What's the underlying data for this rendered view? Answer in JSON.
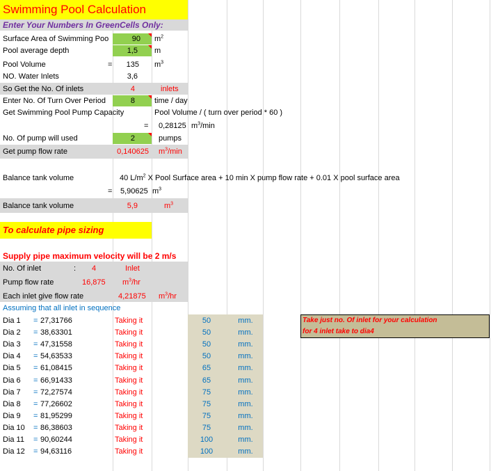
{
  "title": "Swimming Pool Calculation",
  "subtitle": "Enter Your Numbers In GreenCells Only:",
  "colors": {
    "yellow": "#ffff00",
    "green": "#92d050",
    "gray": "#d9d9d9",
    "tan": "#ddd9c4",
    "olive": "#c4bd97",
    "red": "#ff0000",
    "blue": "#0070c0"
  },
  "rows": {
    "surface_label": "Surface Area of Swimming Poo",
    "surface_value": "90",
    "surface_unit": "m",
    "surface_sup": "2",
    "depth_label": "Pool average depth",
    "depth_value": "1,5",
    "depth_unit": "m",
    "volume_label": "Pool Volume",
    "volume_eq": "=",
    "volume_value": "135",
    "volume_unit": "m",
    "volume_sup": "3",
    "inlets_label": "NO. Water Inlets",
    "inlets_value": "3,6",
    "get_inlets_label": "So Get the No. Of inlets",
    "get_inlets_value": "4",
    "get_inlets_unit": "inlets",
    "turnover_label": "Enter No. Of Turn Over Period",
    "turnover_value": "8",
    "turnover_unit": "time / day",
    "pump_cap_label": "Get Swimming Pool Pump Capacity",
    "pump_cap_formula": "Pool Volume / ( turn over period * 60 )",
    "pump_cap_eq": "=",
    "pump_cap_value": "0,28125",
    "pump_cap_unit_a": "m",
    "pump_cap_sup": "3",
    "pump_cap_unit_b": "/min",
    "pumps_label": "No. Of pump will used",
    "pumps_value": "2",
    "pumps_unit": "pumps",
    "flow_label": "Get pump flow rate",
    "flow_value": "0,140625",
    "flow_unit_a": "m",
    "flow_sup": "3",
    "flow_unit_b": "/min",
    "balance_label": "Balance tank volume",
    "balance_formula_a": "40 L/m",
    "balance_formula_sup": "2",
    "balance_formula_b": " X Pool Surface area  + 10 min X pump flow rate + 0.01 X pool surface area",
    "balance_eq": "=",
    "balance_calc": "5,90625",
    "balance_calc_unit": "m",
    "balance_calc_sup": "3",
    "balance2_label": "Balance tank volume",
    "balance2_value": "5,9",
    "balance2_unit": "m",
    "balance2_sup": "3"
  },
  "pipe_title": "To calculate pipe sizing",
  "supply_title": "Supply pipe maximum velocity will be 2 m/s",
  "supply": {
    "inlet_label": "No. Of inlet",
    "inlet_colon": ":",
    "inlet_value": "4",
    "inlet_unit": "Inlet",
    "pump_label": "Pump flow rate",
    "pump_value": "16,875",
    "pump_unit_a": "m",
    "pump_sup": "3",
    "pump_unit_b": "/hr",
    "each_label": "Each inlet give flow rate",
    "each_value": "4,21875",
    "each_unit_a": "m",
    "each_sup": "3",
    "each_unit_b": "/hr",
    "assume": "Assuming that all inlet in sequence"
  },
  "note": {
    "line1": "Take just no. Of inlet for your calculation",
    "line2": "for 4 inlet take to dia4"
  },
  "dia_rows": [
    {
      "name": "Dia 1",
      "eq": "=",
      "calc": "27,31766",
      "taking": "Taking it",
      "size": "50",
      "unit": "mm."
    },
    {
      "name": "Dia 2",
      "eq": "=",
      "calc": "38,63301",
      "taking": "Taking it",
      "size": "50",
      "unit": "mm."
    },
    {
      "name": "Dia 3",
      "eq": "=",
      "calc": "47,31558",
      "taking": "Taking it",
      "size": "50",
      "unit": "mm."
    },
    {
      "name": "Dia 4",
      "eq": "=",
      "calc": "54,63533",
      "taking": "Taking it",
      "size": "50",
      "unit": "mm."
    },
    {
      "name": "Dia 5",
      "eq": "=",
      "calc": "61,08415",
      "taking": "Taking it",
      "size": "65",
      "unit": "mm."
    },
    {
      "name": "Dia 6",
      "eq": "=",
      "calc": "66,91433",
      "taking": "Taking it",
      "size": "65",
      "unit": "mm."
    },
    {
      "name": "Dia 7",
      "eq": "=",
      "calc": "72,27574",
      "taking": "Taking it",
      "size": "75",
      "unit": "mm."
    },
    {
      "name": "Dia 8",
      "eq": "=",
      "calc": "77,26602",
      "taking": "Taking it",
      "size": "75",
      "unit": "mm."
    },
    {
      "name": "Dia 9",
      "eq": "=",
      "calc": "81,95299",
      "taking": "Taking it",
      "size": "75",
      "unit": "mm."
    },
    {
      "name": "Dia 10",
      "eq": "=",
      "calc": "86,38603",
      "taking": "Taking it",
      "size": "75",
      "unit": "mm."
    },
    {
      "name": "Dia 11",
      "eq": "=",
      "calc": "90,60244",
      "taking": "Taking it",
      "size": "100",
      "unit": "mm."
    },
    {
      "name": "Dia 12",
      "eq": "=",
      "calc": "94,63116",
      "taking": "Taking it",
      "size": "100",
      "unit": "mm."
    }
  ]
}
